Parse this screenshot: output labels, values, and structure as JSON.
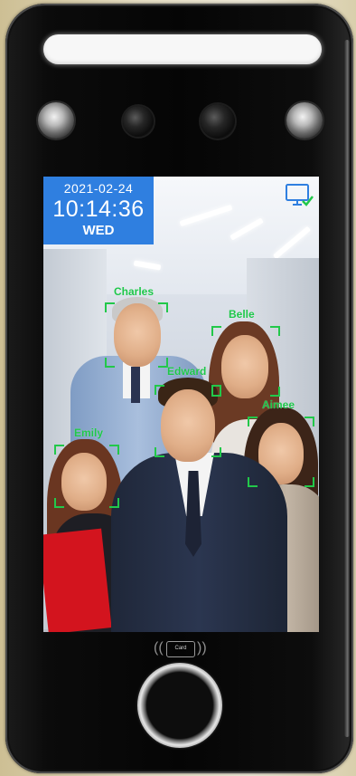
{
  "screen": {
    "date": "2021-02-24",
    "time": "10:14:36",
    "day": "WED",
    "status_icon": "monitor-check-icon",
    "accent_color": "#2f7fe0",
    "detection_color": "#22c84a"
  },
  "faces": [
    {
      "name": "Charles"
    },
    {
      "name": "Belle"
    },
    {
      "name": "Edward"
    },
    {
      "name": "Aimee"
    },
    {
      "name": "Emily"
    }
  ],
  "card_reader": {
    "label": "Card",
    "icon": "nfc-card-icon"
  },
  "fingerprint_sensor": {
    "icon": "fingerprint-sensor-icon"
  }
}
